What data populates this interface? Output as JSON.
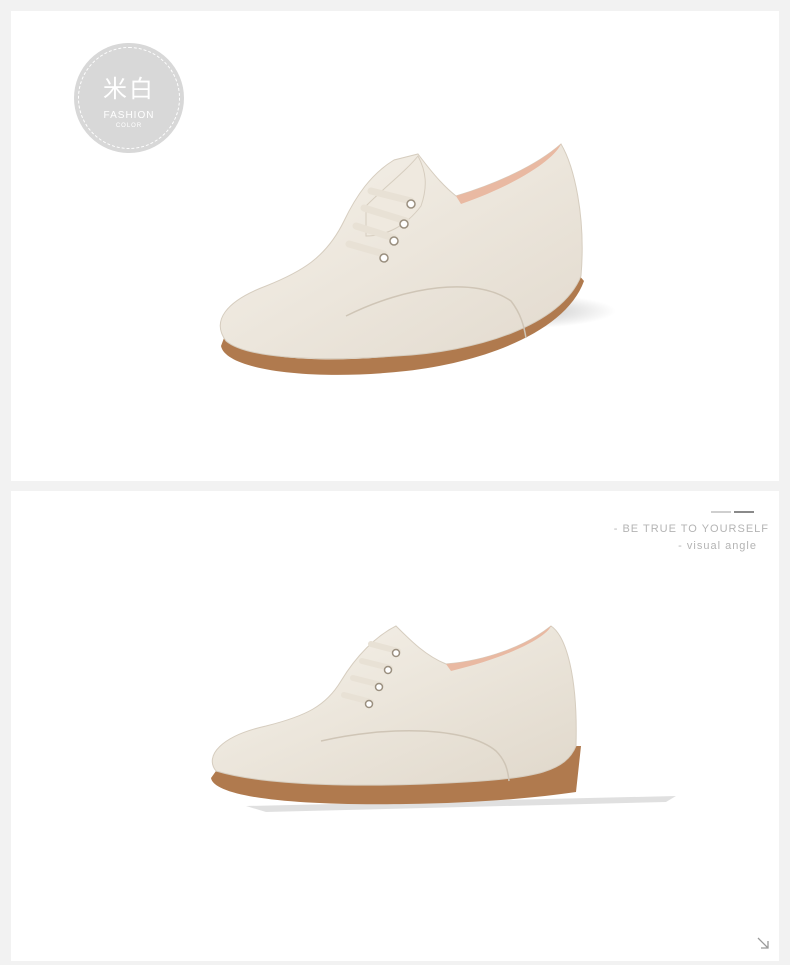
{
  "color_badge": {
    "label": "米白",
    "sub_label": "FASHION",
    "sub_label_small": "COLOR"
  },
  "caption": {
    "line1": "- BE TRUE TO YOURSELF",
    "line2": "- visual angle"
  },
  "icons": {
    "scroll_down": "arrow-down-right-icon"
  },
  "colors": {
    "leather": "#ece6dc",
    "sole": "#b07a4e",
    "badge": "#d8d8d8"
  }
}
